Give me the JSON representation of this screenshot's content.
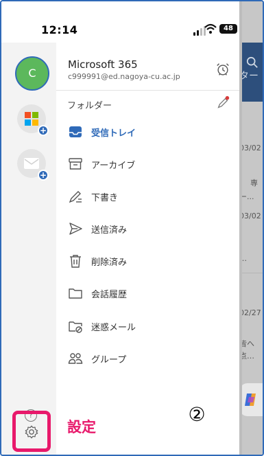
{
  "status": {
    "time": "12:14",
    "battery": "48"
  },
  "account": {
    "avatar_letter": "C",
    "name": "Microsoft 365",
    "email": "c999991@ed.nagoya-cu.ac.jp"
  },
  "folders_label": "フォルダー",
  "folders": [
    {
      "label": "受信トレイ",
      "icon": "inbox-icon",
      "active": true
    },
    {
      "label": "アーカイブ",
      "icon": "archive-icon",
      "active": false
    },
    {
      "label": "下書き",
      "icon": "draft-icon",
      "active": false
    },
    {
      "label": "送信済み",
      "icon": "send-icon",
      "active": false
    },
    {
      "label": "削除済み",
      "icon": "trash-icon",
      "active": false
    },
    {
      "label": "会話履歴",
      "icon": "folder-icon",
      "active": false
    },
    {
      "label": "迷惑メール",
      "icon": "junk-folder-icon",
      "active": false
    },
    {
      "label": "グループ",
      "icon": "group-icon",
      "active": false
    }
  ],
  "settings_label": "設定",
  "annotation_number": "②",
  "background": {
    "tab": "ター",
    "date1": "03/02",
    "snippet1a": "専",
    "snippet1b": "ー...",
    "date2": "03/02",
    "snippet2": "…",
    "date3": "02/27",
    "snippet3a": "皆へ",
    "snippet3b": "点…"
  },
  "colors": {
    "accent": "#2f6ab8",
    "highlight": "#e8196b",
    "avatar": "#5cb85c"
  }
}
